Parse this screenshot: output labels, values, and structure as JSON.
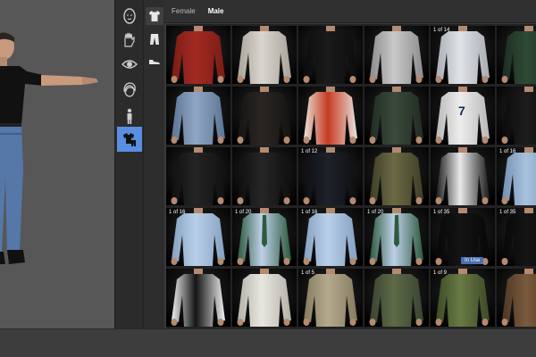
{
  "tabs": [
    {
      "label": "Female",
      "active": false
    },
    {
      "label": "Male",
      "active": true
    }
  ],
  "rail": [
    {
      "icon": "head-icon",
      "active": false
    },
    {
      "icon": "hand-icon",
      "active": false
    },
    {
      "icon": "eye-icon",
      "active": false
    },
    {
      "icon": "hair-icon",
      "active": false
    },
    {
      "icon": "body-icon",
      "active": false
    },
    {
      "icon": "clothing-icon",
      "active": true
    }
  ],
  "subrail": [
    {
      "icon": "shirt-icon",
      "active": true
    },
    {
      "icon": "pants-icon",
      "active": false
    },
    {
      "icon": "shoe-icon",
      "active": false
    }
  ],
  "colors": {
    "accent": "#5a8ee0",
    "in_use": "#4a6fb3"
  },
  "in_use_label": "In Use",
  "grid": [
    [
      {
        "garment": "red sweater",
        "badge": ""
      },
      {
        "garment": "white jacket",
        "badge": ""
      },
      {
        "garment": "black jacket",
        "badge": ""
      },
      {
        "garment": "plaid shirt",
        "badge": ""
      },
      {
        "garment": "light shirt",
        "badge": "1 of 14"
      },
      {
        "garment": "green sweater",
        "badge": ""
      }
    ],
    [
      {
        "garment": "denim jacket",
        "badge": ""
      },
      {
        "garment": "dark jacket",
        "badge": ""
      },
      {
        "garment": "red track jacket",
        "badge": ""
      },
      {
        "garment": "green jacket",
        "badge": ""
      },
      {
        "garment": "tank top 7",
        "badge": ""
      },
      {
        "garment": "graphic tee",
        "badge": ""
      }
    ],
    [
      {
        "garment": "black puffer",
        "badge": ""
      },
      {
        "garment": "leather jacket",
        "badge": ""
      },
      {
        "garment": "suit",
        "badge": "1 of 12"
      },
      {
        "garment": "camo backpack",
        "badge": ""
      },
      {
        "garment": "armor",
        "badge": ""
      },
      {
        "garment": "blue shirt",
        "badge": "1 of 16"
      }
    ],
    [
      {
        "garment": "light blue shirt",
        "badge": "1 of 16"
      },
      {
        "garment": "shirt with tie",
        "badge": "1 of 20"
      },
      {
        "garment": "light blue shirt",
        "badge": "1 of 16"
      },
      {
        "garment": "shirt with tie",
        "badge": "1 of 20"
      },
      {
        "garment": "black tee",
        "badge": "1 of 35",
        "in_use": true
      },
      {
        "garment": "black tee",
        "badge": "1 of 35"
      }
    ],
    [
      {
        "garment": "tuxedo",
        "badge": ""
      },
      {
        "garment": "white tuxedo",
        "badge": ""
      },
      {
        "garment": "khaki shirt",
        "badge": "1 of 5"
      },
      {
        "garment": "camo shirt",
        "badge": ""
      },
      {
        "garment": "camo jacket",
        "badge": "1 of 9"
      },
      {
        "garment": "brown jacket",
        "badge": ""
      }
    ]
  ]
}
